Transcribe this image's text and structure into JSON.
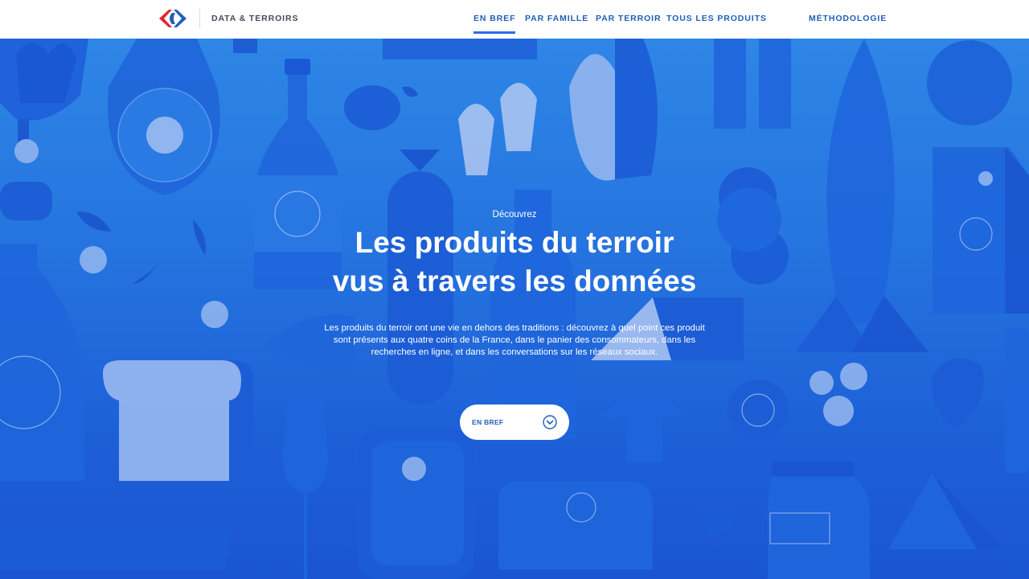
{
  "header": {
    "brand": "DATA & TERROIRS",
    "nav": [
      "EN BREF",
      "PAR FAMILLE",
      "PAR TERROIR",
      "TOUS LES PRODUITS",
      "MÉTHODOLOGIE"
    ]
  },
  "hero": {
    "kicker": "Découvrez",
    "title_line1": "Les produits du terroir",
    "title_line2": "vus à travers les données",
    "description": "Les produits du terroir ont une vie en dehors des traditions : découvrez à quel point ces produit sont présents aux quatre coins de la France, dans le panier des consommateurs, dans les recherches en ligne, et dans les conversations sur les réseaux sociaux.",
    "cta_label": "EN BREF",
    "cta_icon": "chevron-down-circle-icon"
  },
  "colors": {
    "brand_blue": "#1f5fb8",
    "brand_red": "#e3262f",
    "hero_top": "#2e86e6",
    "hero_bottom": "#1a55cf"
  }
}
